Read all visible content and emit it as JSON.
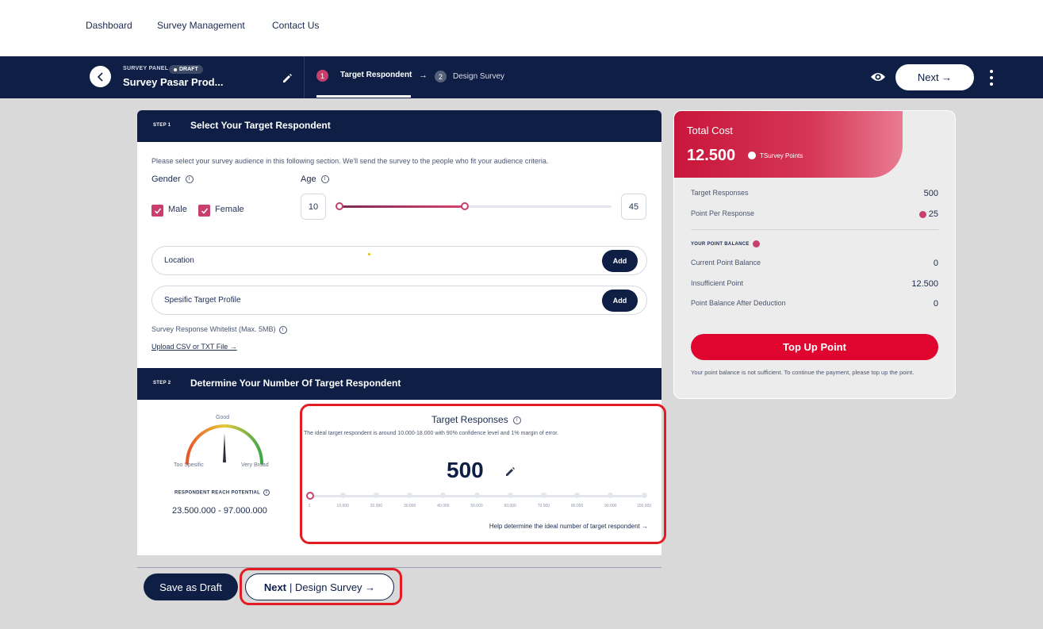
{
  "nav": {
    "items": [
      "Dashboard",
      "Survey Management",
      "Contact Us"
    ]
  },
  "header": {
    "panel_label": "SURVEY PANEL",
    "badge": "DRAFT",
    "survey_title": "Survey Pasar Prod...",
    "steps": [
      {
        "num": "1",
        "label": "Target Respondent"
      },
      {
        "num": "2",
        "label": "Design Survey"
      }
    ],
    "step_arrow": "→",
    "next_label": "Next →"
  },
  "step1": {
    "tag": "STEP 1",
    "title": "Select Your Target Respondent",
    "intro": "Please select your survey audience in this following section. We'll send the survey to the people who fit your audience criteria.",
    "gender_label": "Gender",
    "gender_options": [
      "Male",
      "Female"
    ],
    "age_label": "Age",
    "age_min": "10",
    "age_max": "45",
    "location_label": "Location",
    "profile_label": "Spesific Target Profile",
    "add_label": "Add",
    "whitelist_label": "Survey Response Whitelist (Max. 5MB)",
    "upload_link": "Upload CSV or TXT File →"
  },
  "step2": {
    "tag": "STEP 2",
    "title": "Determine Your Number Of Target Respondent",
    "gauge": {
      "good": "Good",
      "too": "Too Spesific",
      "broad": "Very Broad"
    },
    "reach_label": "RESPONDENT REACH POTENTIAL",
    "reach_value": "23.500.000 - 97.000.000",
    "target_title": "Target Responses",
    "target_desc": "The ideal target respondent is around 10.000-18.000 with 90% confidence level and 1% margin of error.",
    "target_value": "500",
    "ticks": [
      "1",
      "10.000",
      "20.000",
      "30.000",
      "40.000",
      "50.000",
      "60.000",
      "70.000",
      "80.000",
      "90.000",
      "100.000"
    ],
    "help_link": "Help determine the ideal number of target respondent →"
  },
  "footer": {
    "save_draft": "Save as Draft",
    "next_bold": "Next",
    "next_rest": "| Design Survey →"
  },
  "cost": {
    "title": "Total Cost",
    "value": "12.500",
    "unit": "TSurvey Points",
    "target_responses_label": "Target Responses",
    "target_responses_value": "500",
    "point_per_response_label": "Point Per Response",
    "point_per_response_value": "25",
    "balance_head": "YOUR POINT BALANCE",
    "current_label": "Current Point Balance",
    "current_value": "0",
    "insufficient_label": "Insufficient Point",
    "insufficient_value": "12.500",
    "after_label": "Point Balance After Deduction",
    "after_value": "0",
    "topup_label": "Top Up Point",
    "warning": "Your point balance is not sufficient. To continue the payment, please top up the point."
  },
  "colors": {
    "navy": "#0e1e45",
    "accent": "#c93f6b",
    "red": "#e0052f",
    "highlight": "#e31b23"
  }
}
